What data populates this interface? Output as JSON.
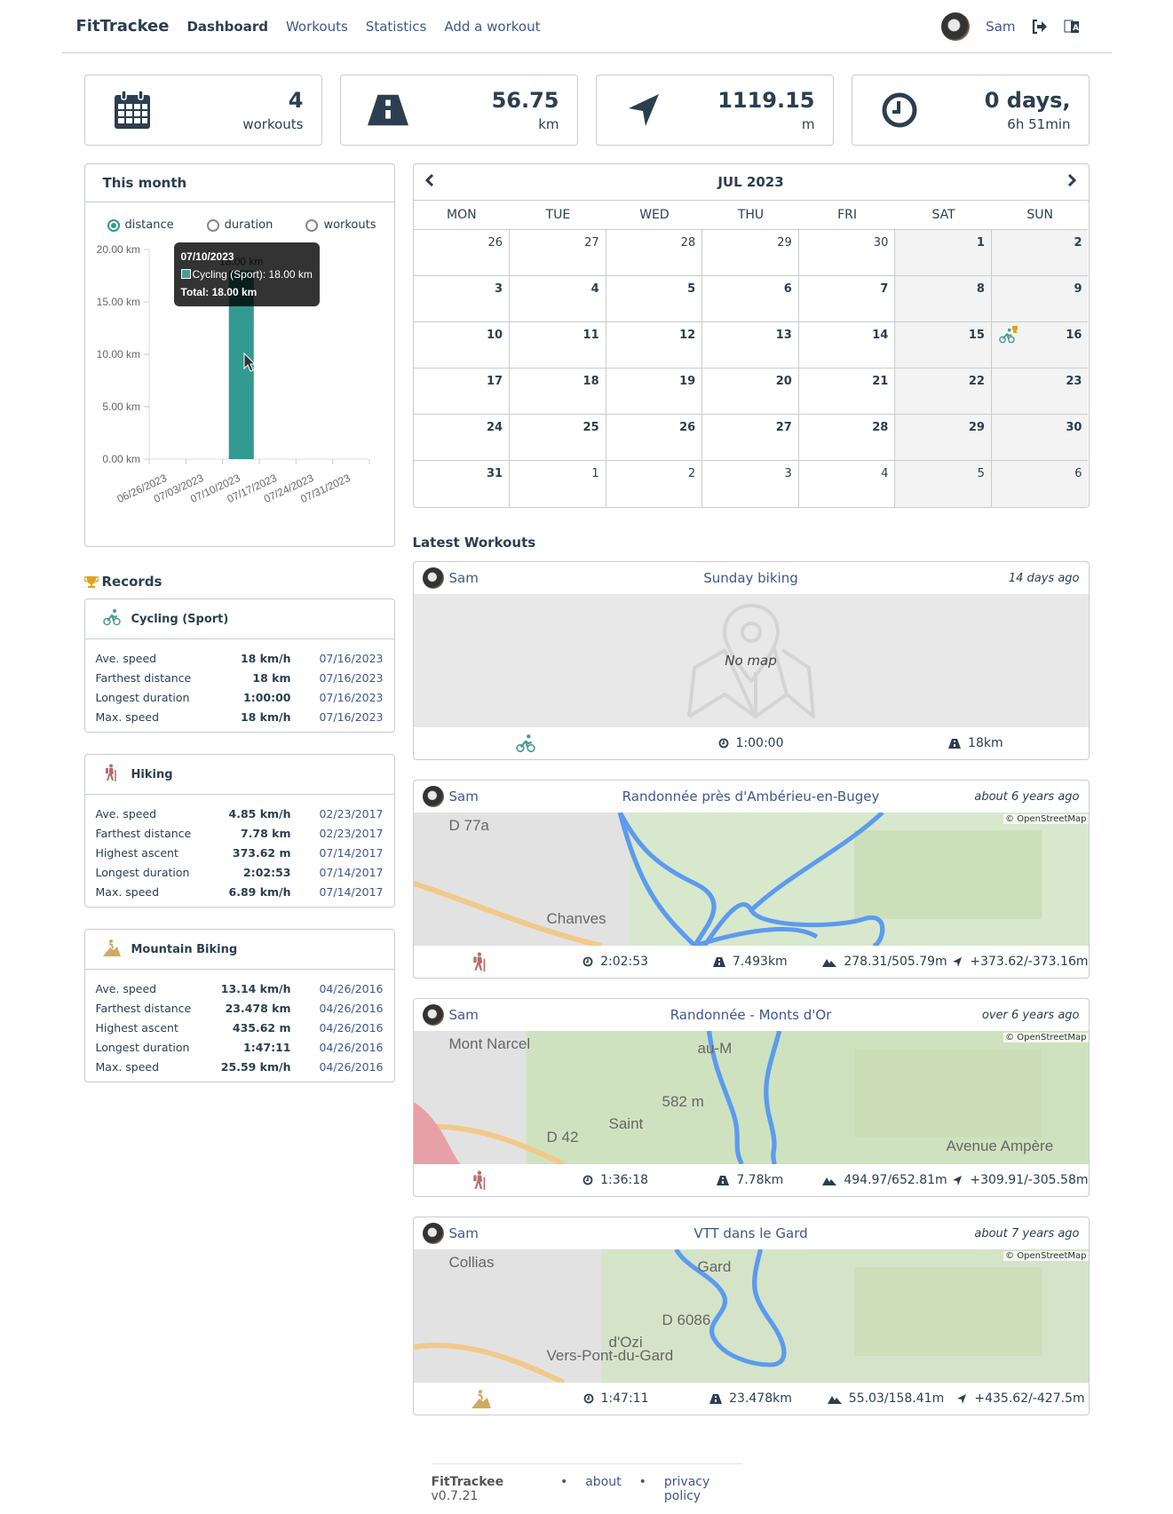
{
  "nav": {
    "brand": "FitTrackee",
    "links": [
      "Dashboard",
      "Workouts",
      "Statistics",
      "Add a workout"
    ],
    "active": "Dashboard",
    "username": "Sam"
  },
  "stats": [
    {
      "icon": "calendar-icon",
      "value": "4",
      "label": "workouts"
    },
    {
      "icon": "road-icon",
      "value": "56.75",
      "label": "km"
    },
    {
      "icon": "location-arrow-icon",
      "value": "1119.15",
      "label": "m"
    },
    {
      "icon": "clock-icon",
      "value": "0 days,",
      "label": "6h 51min"
    }
  ],
  "month_chart": {
    "title": "This month",
    "radios": [
      {
        "label": "distance",
        "checked": true
      },
      {
        "label": "duration",
        "checked": false
      },
      {
        "label": "workouts",
        "checked": false
      }
    ],
    "tooltip": {
      "date": "07/10/2023",
      "line": "Cycling (Sport): 18.00 km",
      "total": "Total: 18.00 km"
    }
  },
  "chart_data": {
    "type": "bar",
    "title": "",
    "xlabel": "",
    "ylabel": "",
    "categories": [
      "06/26/2023",
      "07/03/2023",
      "07/10/2023",
      "07/17/2023",
      "07/24/2023",
      "07/31/2023"
    ],
    "series": [
      {
        "name": "Cycling (Sport)",
        "color": "#339a92",
        "values": [
          0,
          0,
          18,
          0,
          0,
          0
        ]
      }
    ],
    "yticks": [
      "0.00 km",
      "5.00 km",
      "10.00 km",
      "15.00 km",
      "20.00 km"
    ],
    "ylim": [
      0,
      20
    ],
    "data_label": "18.00 km",
    "legend": "none"
  },
  "records": {
    "title": "Records",
    "sports": [
      {
        "name": "Cycling (Sport)",
        "icon": "cycling-icon",
        "color": "#4a9b94",
        "rows": [
          {
            "label": "Ave. speed",
            "value": "18 km/h",
            "date": "07/16/2023"
          },
          {
            "label": "Farthest distance",
            "value": "18 km",
            "date": "07/16/2023"
          },
          {
            "label": "Longest duration",
            "value": "1:00:00",
            "date": "07/16/2023"
          },
          {
            "label": "Max. speed",
            "value": "18 km/h",
            "date": "07/16/2023"
          }
        ]
      },
      {
        "name": "Hiking",
        "icon": "hiking-icon",
        "color": "#b86b6b",
        "rows": [
          {
            "label": "Ave. speed",
            "value": "4.85 km/h",
            "date": "02/23/2017"
          },
          {
            "label": "Farthest distance",
            "value": "7.78 km",
            "date": "02/23/2017"
          },
          {
            "label": "Highest ascent",
            "value": "373.62 m",
            "date": "07/14/2017"
          },
          {
            "label": "Longest duration",
            "value": "2:02:53",
            "date": "07/14/2017"
          },
          {
            "label": "Max. speed",
            "value": "6.89 km/h",
            "date": "07/14/2017"
          }
        ]
      },
      {
        "name": "Mountain Biking",
        "icon": "mountain-biking-icon",
        "color": "#d3a860",
        "rows": [
          {
            "label": "Ave. speed",
            "value": "13.14 km/h",
            "date": "04/26/2016"
          },
          {
            "label": "Farthest distance",
            "value": "23.478 km",
            "date": "04/26/2016"
          },
          {
            "label": "Highest ascent",
            "value": "435.62 m",
            "date": "04/26/2016"
          },
          {
            "label": "Longest duration",
            "value": "1:47:11",
            "date": "04/26/2016"
          },
          {
            "label": "Max. speed",
            "value": "25.59 km/h",
            "date": "04/26/2016"
          }
        ]
      }
    ]
  },
  "calendar": {
    "month": "JUL 2023",
    "days_of_week": [
      "MON",
      "TUE",
      "WED",
      "THU",
      "FRI",
      "SAT",
      "SUN"
    ],
    "weeks": [
      [
        "26",
        "27",
        "28",
        "29",
        "30",
        "1",
        "2"
      ],
      [
        "3",
        "4",
        "5",
        "6",
        "7",
        "8",
        "9"
      ],
      [
        "10",
        "11",
        "12",
        "13",
        "14",
        "15",
        "16"
      ],
      [
        "17",
        "18",
        "19",
        "20",
        "21",
        "22",
        "23"
      ],
      [
        "24",
        "25",
        "26",
        "27",
        "28",
        "29",
        "30"
      ],
      [
        "31",
        "1",
        "2",
        "3",
        "4",
        "5",
        "6"
      ]
    ],
    "workout_day": "16"
  },
  "latest": {
    "title": "Latest Workouts",
    "no_map": "No map",
    "attribution": "© OpenStreetMap",
    "workouts": [
      {
        "user": "Sam",
        "title": "Sunday biking",
        "ago": "14 days ago",
        "sport": "cycling-icon",
        "duration": "1:00:00",
        "distance": "18km",
        "elevation": "",
        "ascent": "",
        "map": false
      },
      {
        "user": "Sam",
        "title": "Randonnée près d'Ambérieu-en-Bugey",
        "ago": "about 6 years ago",
        "sport": "hiking-icon",
        "duration": "2:02:53",
        "distance": "7.493km",
        "elevation": "278.31/505.79m",
        "ascent": "+373.62/-373.16m",
        "map": true,
        "labels": [
          "Chanves",
          "D 77a"
        ]
      },
      {
        "user": "Sam",
        "title": "Randonnée - Monts d'Or",
        "ago": "over 6 years ago",
        "sport": "hiking-icon",
        "duration": "1:36:18",
        "distance": "7.78km",
        "elevation": "494.97/652.81m",
        "ascent": "+309.91/-305.58m",
        "map": true,
        "labels": [
          "D 42",
          "Mont Narcel",
          "582 m",
          "Saint",
          "au-M",
          "Avenue Ampère"
        ]
      },
      {
        "user": "Sam",
        "title": "VTT dans le Gard",
        "ago": "about 7 years ago",
        "sport": "mountain-biking-icon",
        "duration": "1:47:11",
        "distance": "23.478km",
        "elevation": "55.03/158.41m",
        "ascent": "+435.62/-427.5m",
        "map": true,
        "labels": [
          "Vers-Pont-du-Gard",
          "Collias",
          "D 6086",
          "d'Ozi",
          "Gard"
        ]
      }
    ]
  },
  "footer": {
    "brand": "FitTrackee",
    "version": "v0.7.21",
    "about": "about",
    "privacy": "privacy policy",
    "sep": "•"
  },
  "colors": {
    "accent": "#339a92",
    "text": "#2c3e50",
    "link": "#40578a",
    "border": "#c8ccd2"
  }
}
